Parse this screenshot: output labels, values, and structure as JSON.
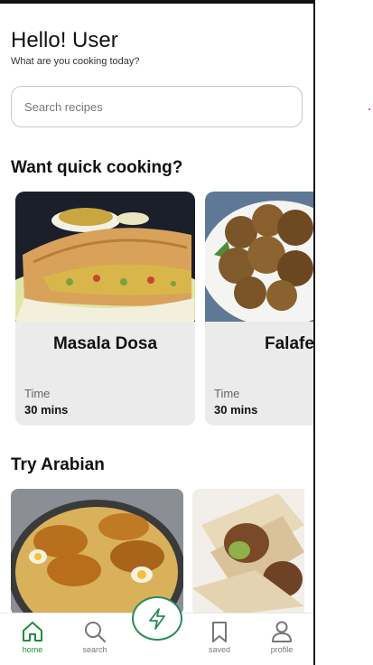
{
  "header": {
    "greeting": "Hello! User",
    "subtitle": "What are you cooking today?"
  },
  "search": {
    "placeholder": "Search recipes"
  },
  "sections": {
    "quick": {
      "title": "Want quick cooking?",
      "cards": [
        {
          "name": "Masala Dosa",
          "time_label": "Time",
          "time": "30 mins"
        },
        {
          "name": "Falafel",
          "time_label": "Time",
          "time": "30 mins"
        }
      ]
    },
    "arabian": {
      "title": "Try Arabian"
    }
  },
  "nav": {
    "items": [
      {
        "label": "home",
        "icon": "home-icon"
      },
      {
        "label": "search",
        "icon": "search-icon"
      },
      {
        "label": "",
        "icon": "lightning-icon"
      },
      {
        "label": "saved",
        "icon": "bookmark-icon"
      },
      {
        "label": "profile",
        "icon": "person-icon"
      }
    ]
  },
  "colors": {
    "accent": "#1e8e3e",
    "fab_border": "#2a8a5a",
    "card_bg": "#ebebeb"
  }
}
